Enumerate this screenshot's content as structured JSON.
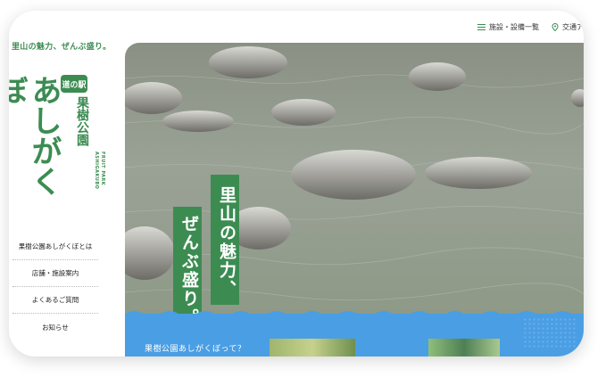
{
  "top_nav": {
    "facilities_label": "施設・設備一覧",
    "facilities_icon": "list-icon",
    "access_label": "交通ア",
    "access_icon": "map-pin-icon"
  },
  "sidebar": {
    "tagline": "里山の魅力、ぜんぶ盛り。",
    "logo": {
      "badge": "道の駅",
      "name": "果樹公園",
      "main": "あしがくぼ",
      "english": "FRUIT PARK ASHIGAKUBO"
    },
    "menu": [
      {
        "label": "果樹公園あしがくぼとは"
      },
      {
        "label": "店舗・施設案内"
      },
      {
        "label": "よくあるご質問"
      },
      {
        "label": "お知らせ"
      }
    ]
  },
  "hero": {
    "copy_line1": "里山の魅力、",
    "copy_line2": "ぜんぶ盛り。"
  },
  "intro": {
    "heading": "果樹公園あしがくぼって？"
  },
  "colors": {
    "brand_green": "#3c8c52",
    "section_blue": "#4a9ee4"
  }
}
